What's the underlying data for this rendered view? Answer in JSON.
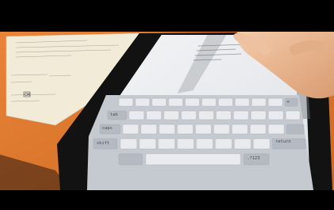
{
  "photo": {
    "subject": "hand-typing-on-tablet-keyboard",
    "colors": {
      "letterbox": "#000000",
      "table": "#e07a2c",
      "paper": "#f1ebd8",
      "tablet_bezel": "#121212",
      "screen": "#eceef0",
      "keyboard": "#c5c9d0",
      "key": "#e9ebee",
      "skin": "#e9b896"
    }
  },
  "keyboard": {
    "keys": {
      "tab": "tab",
      "return": "return",
      "shift": "shift",
      "caps": "caps",
      "delete": "⌫",
      "numbers": ".?123"
    }
  },
  "paper_form": {
    "checkbox_label": "OK"
  }
}
